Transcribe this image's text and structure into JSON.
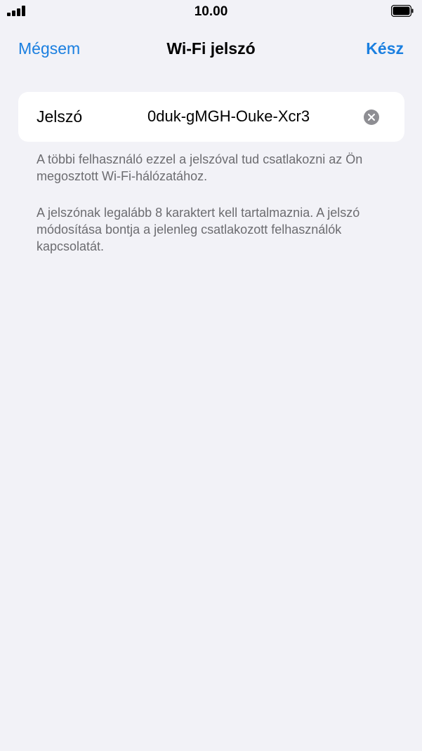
{
  "status_bar": {
    "time": "10.00"
  },
  "nav": {
    "cancel_label": "Mégsem",
    "title": "Wi-Fi jelszó",
    "done_label": "Kész"
  },
  "password_field": {
    "label": "Jelszó",
    "value": "0duk-gMGH-Ouke-Xcr3"
  },
  "footer": {
    "info_text": "A többi felhasználó ezzel a jelszóval tud csatlakozni az Ön megosztott Wi-Fi-hálózatához.",
    "rules_text": "A jelszónak legalább 8 karaktert kell tartalmaznia. A jelszó módosítása bontja a jelenleg csatlakozott felhasználók kapcsolatát."
  },
  "colors": {
    "accent": "#1a7fe0",
    "background": "#f2f2f7",
    "secondary_text": "#6c6c70",
    "clear_icon_bg": "#8e8e93"
  },
  "icons": {
    "signal": "cellular-signal-icon",
    "battery": "battery-icon",
    "clear": "clear-x-circle-icon"
  }
}
